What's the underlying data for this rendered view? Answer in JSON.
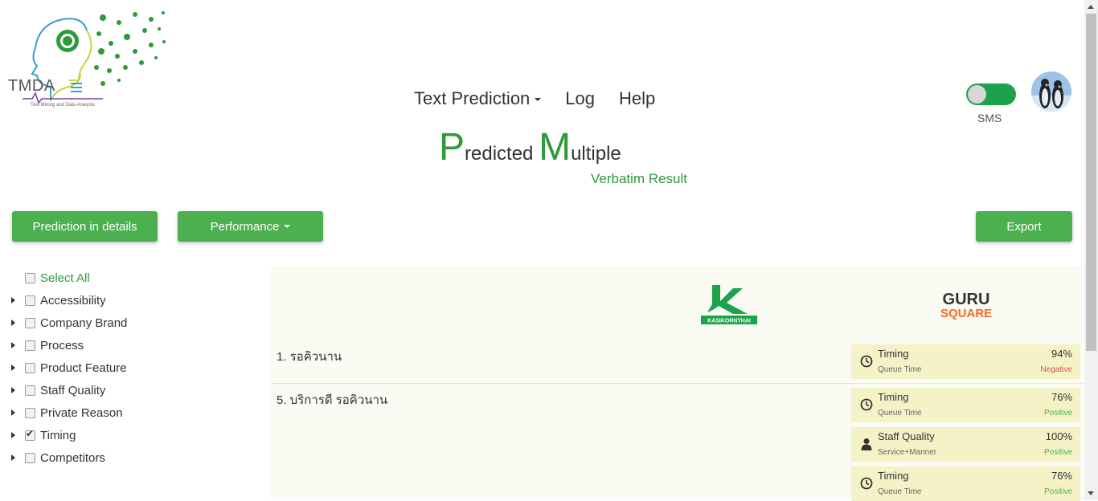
{
  "logo": {
    "name": "TMDA",
    "tagline": "Text Mining and Data Analysis"
  },
  "nav": {
    "text_prediction": "Text Prediction",
    "log": "Log",
    "help": "Help"
  },
  "sms": {
    "label": "SMS",
    "enabled": true
  },
  "title": {
    "p_big": "P",
    "p_rest": "redicted ",
    "m_big": "M",
    "m_rest": "ultiple",
    "subtitle": "Verbatim Result"
  },
  "toolbar": {
    "prediction_details": "Prediction in details",
    "performance": "Performance",
    "export": "Export"
  },
  "tree": {
    "select_all": "Select All",
    "items": [
      {
        "label": "Accessibility",
        "checked": false
      },
      {
        "label": "Company Brand",
        "checked": false
      },
      {
        "label": "Process",
        "checked": false
      },
      {
        "label": "Product Feature",
        "checked": false
      },
      {
        "label": "Staff Quality",
        "checked": false
      },
      {
        "label": "Private Reason",
        "checked": false
      },
      {
        "label": "Timing",
        "checked": true
      },
      {
        "label": "Competitors",
        "checked": false
      }
    ]
  },
  "brands": {
    "kasikorn": "KASIKORNTHAI",
    "guru_top": "GURU",
    "guru_bottom": "SQUARE"
  },
  "results": [
    {
      "text": "1. รอคิวนาน",
      "cards": [
        {
          "icon": "clock-icon",
          "category": "Timing",
          "sub": "Queue Time",
          "pct": "94%",
          "sentiment": "Negative",
          "color": "#d9534f"
        }
      ]
    },
    {
      "text": "5. บริการดี รอคิวนาน",
      "cards": [
        {
          "icon": "clock-icon",
          "category": "Timing",
          "sub": "Queue Time",
          "pct": "76%",
          "sentiment": "Positive",
          "color": "#4caf50"
        },
        {
          "icon": "person-icon",
          "category": "Staff Quality",
          "sub": "Service+Manner",
          "pct": "100%",
          "sentiment": "Positive",
          "color": "#4caf50"
        },
        {
          "icon": "clock-icon",
          "category": "Timing",
          "sub": "Queue Time",
          "pct": "76%",
          "sentiment": "Positive",
          "color": "#4caf50"
        }
      ]
    }
  ]
}
